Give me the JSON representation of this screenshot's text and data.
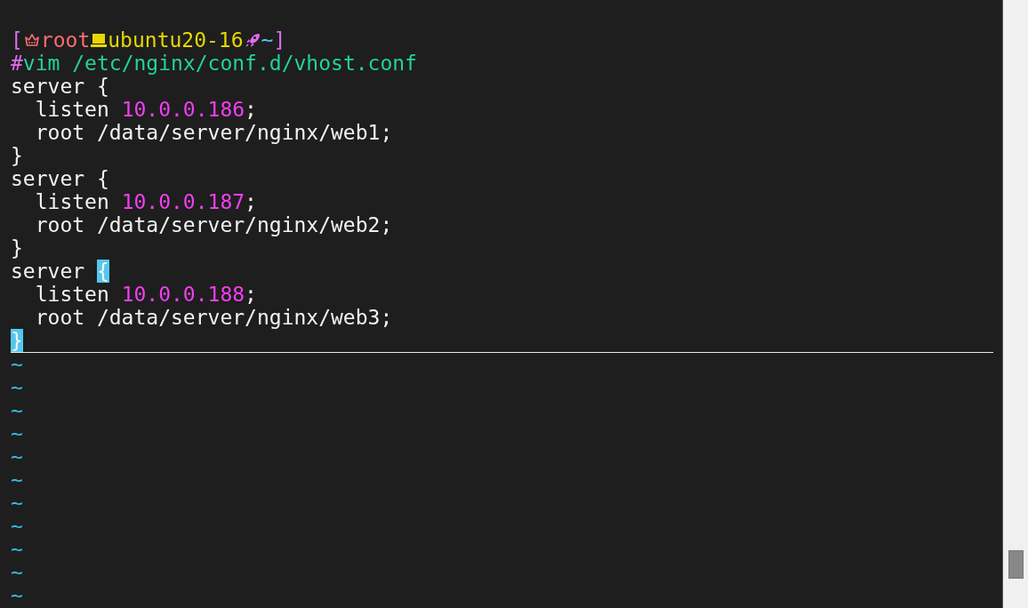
{
  "prompt": {
    "open_bracket": "[",
    "user": "root",
    "host": "ubuntu20-16",
    "path": "~",
    "close_bracket": "]"
  },
  "command": [
    {
      "text": "#",
      "kind": "symbol"
    },
    {
      "text": "vim /etc/nginx/conf.d/vhost.conf",
      "kind": "command"
    }
  ],
  "buffer": [
    [
      {
        "text": "server {",
        "kind": "code"
      }
    ],
    [
      {
        "text": "  listen ",
        "kind": "code"
      },
      {
        "text": "10.0.0.186",
        "kind": "number"
      },
      {
        "text": ";",
        "kind": "code"
      }
    ],
    [
      {
        "text": "  root /data/server/nginx/web1;",
        "kind": "code"
      }
    ],
    [
      {
        "text": "}",
        "kind": "code"
      }
    ],
    [
      {
        "text": "server {",
        "kind": "code"
      }
    ],
    [
      {
        "text": "  listen ",
        "kind": "code"
      },
      {
        "text": "10.0.0.187",
        "kind": "number"
      },
      {
        "text": ";",
        "kind": "code"
      }
    ],
    [
      {
        "text": "  root /data/server/nginx/web2;",
        "kind": "code"
      }
    ],
    [
      {
        "text": "}",
        "kind": "code"
      }
    ],
    [
      {
        "text": "server ",
        "kind": "code"
      },
      {
        "text": "{",
        "kind": "match"
      }
    ],
    [
      {
        "text": "  listen ",
        "kind": "code"
      },
      {
        "text": "10.0.0.188",
        "kind": "number"
      },
      {
        "text": ";",
        "kind": "code"
      }
    ],
    [
      {
        "text": "  root /data/server/nginx/web3;",
        "kind": "code"
      }
    ],
    [
      {
        "text": "}",
        "kind": "match"
      }
    ]
  ],
  "empty_lines": [
    "~",
    "~",
    "~",
    "~",
    "~",
    "~",
    "~",
    "~",
    "~",
    "~",
    "~"
  ]
}
